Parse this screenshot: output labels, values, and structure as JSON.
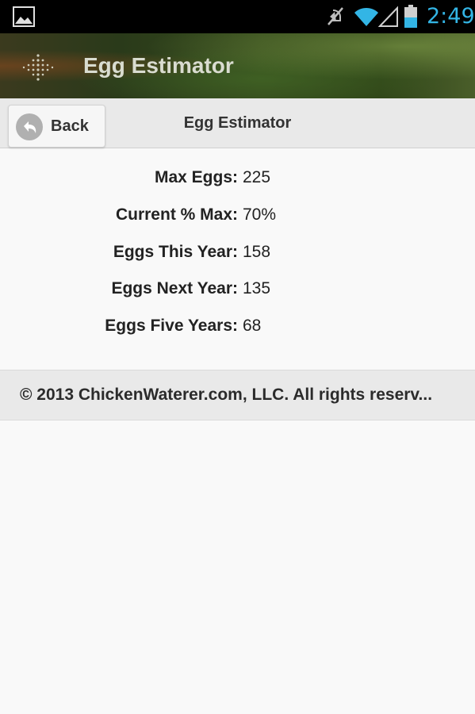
{
  "status_bar": {
    "time": "2:49",
    "icons": [
      "gallery-icon",
      "mute-icon",
      "wifi-icon",
      "signal-icon",
      "battery-icon"
    ],
    "accent_color": "#33b5e5"
  },
  "action_bar": {
    "title": "Egg Estimator",
    "icon": "app-icon"
  },
  "header": {
    "back_label": "Back",
    "title": "Egg Estimator"
  },
  "results": [
    {
      "label": "Max Eggs:",
      "value": "225"
    },
    {
      "label": "Current % Max:",
      "value": "70%"
    },
    {
      "label": "Eggs This Year:",
      "value": "158"
    },
    {
      "label": "Eggs Next Year:",
      "value": "135"
    },
    {
      "label": "Eggs Five Years:",
      "value": "68"
    }
  ],
  "footer": {
    "text": "© 2013 ChickenWaterer.com, LLC. All rights reserv..."
  }
}
